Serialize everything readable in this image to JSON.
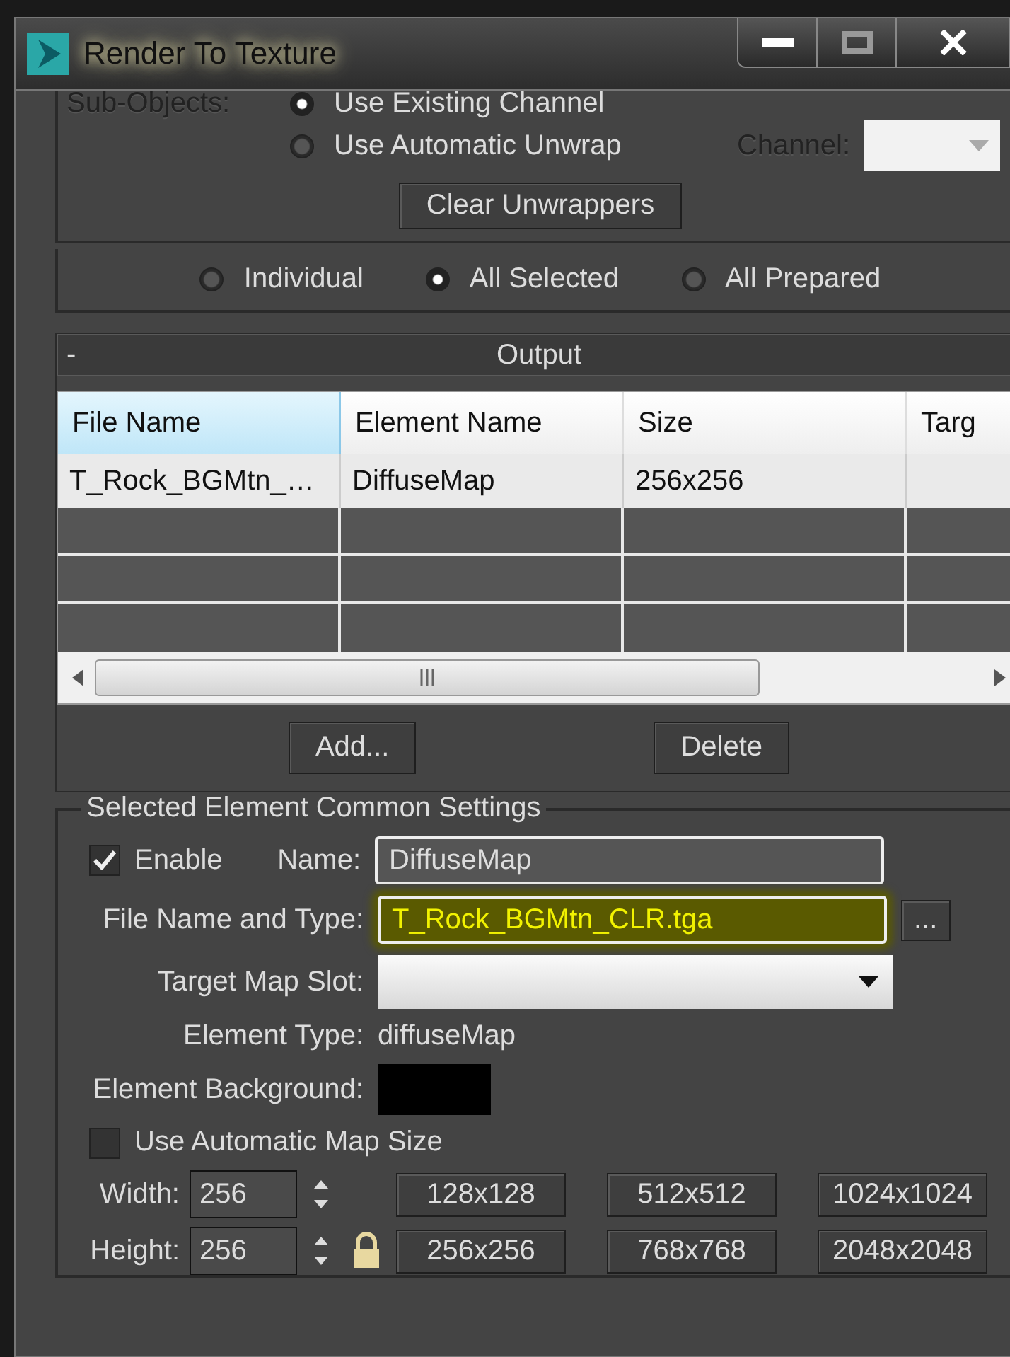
{
  "window": {
    "title": "Render To Texture"
  },
  "sub_objects": {
    "label": "Sub-Objects:",
    "options": [
      {
        "label": "Use Existing Channel",
        "selected": true
      },
      {
        "label": "Use Automatic Unwrap",
        "selected": false
      }
    ],
    "channel_label": "Channel:",
    "clear_button": "Clear Unwrappers"
  },
  "scope": [
    {
      "label": "Individual",
      "selected": false
    },
    {
      "label": "All Selected",
      "selected": true
    },
    {
      "label": "All Prepared",
      "selected": false
    }
  ],
  "output": {
    "collapse": "-",
    "title": "Output",
    "columns": [
      {
        "label": "File Name",
        "selected": true
      },
      {
        "label": "Element Name",
        "selected": false
      },
      {
        "label": "Size",
        "selected": false
      },
      {
        "label": "Targ",
        "selected": false
      }
    ],
    "rows": [
      {
        "cells": [
          "T_Rock_BGMtn_…",
          "DiffuseMap",
          "256x256"
        ]
      }
    ],
    "buttons": [
      "Add...",
      "Delete"
    ]
  },
  "settings": {
    "title": "Selected Element Common Settings",
    "enable": {
      "label": "Enable",
      "checked": true
    },
    "name_label": "Name:",
    "name_value": "DiffuseMap",
    "file_label": "File Name and Type:",
    "file_value": "T_Rock_BGMtn_CLR.tga",
    "file_highlighted": true,
    "browse": "...",
    "target_label": "Target Map Slot:",
    "type_label": "Element Type:",
    "type_value": "diffuseMap",
    "background_label": "Element Background:",
    "auto_size": {
      "label": "Use Automatic Map Size",
      "checked": false
    },
    "width": {
      "label": "Width:",
      "value": "256"
    },
    "height": {
      "label": "Height:",
      "value": "256"
    },
    "presets": [
      "128x128",
      "512x512",
      "1024x1024",
      "256x256",
      "768x768",
      "2048x2048"
    ]
  }
}
